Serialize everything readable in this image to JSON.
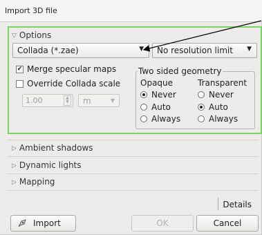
{
  "window": {
    "title": "Import 3D file"
  },
  "options": {
    "header": "Options",
    "format_combo": "Collada (*.zae)",
    "resolution_combo": "No resolution limit",
    "merge_specular": {
      "label": "Merge specular maps",
      "checked": true
    },
    "override_scale": {
      "label": "Override Collada scale",
      "checked": false
    },
    "scale_value": "1.00",
    "scale_unit": "m",
    "two_sided": {
      "title": "Two sided geometry",
      "opaque_label": "Opaque",
      "transparent_label": "Transparent",
      "opaque_options": [
        "Never",
        "Auto",
        "Always"
      ],
      "opaque_selected": "Never",
      "transparent_options": [
        "Never",
        "Auto",
        "Always"
      ],
      "transparent_selected": "Auto"
    }
  },
  "sections": {
    "ambient": "Ambient shadows",
    "dynamic": "Dynamic lights",
    "mapping": "Mapping"
  },
  "footer": {
    "details": "Details",
    "import": "Import",
    "ok": "OK",
    "cancel": "Cancel"
  },
  "colors": {
    "highlight_frame": "#78d65f"
  }
}
